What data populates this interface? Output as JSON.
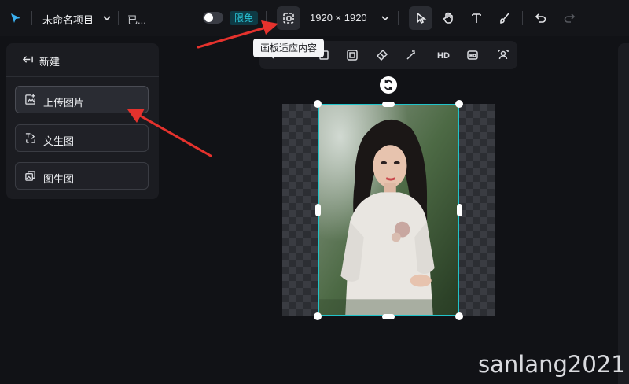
{
  "header": {
    "project_name": "未命名项目",
    "save_status": "已...",
    "free_badge": "限免",
    "canvas_size": "1920 × 1920"
  },
  "tooltip": {
    "text": "画板适应内容"
  },
  "toolbar2": {
    "hd_label": "HD"
  },
  "panel": {
    "title": "新建",
    "items": [
      {
        "label": "上传图片",
        "icon": "upload-image-icon"
      },
      {
        "label": "文生图",
        "icon": "text-to-image-icon"
      },
      {
        "label": "图生图",
        "icon": "image-to-image-icon"
      }
    ]
  },
  "watermark": {
    "text": "sanlang2021"
  },
  "colors": {
    "accent": "#21c3c9",
    "badge_text": "#29c4d6",
    "background": "#111216",
    "arrow": "#e5322d"
  },
  "toggle": {
    "on": false
  }
}
